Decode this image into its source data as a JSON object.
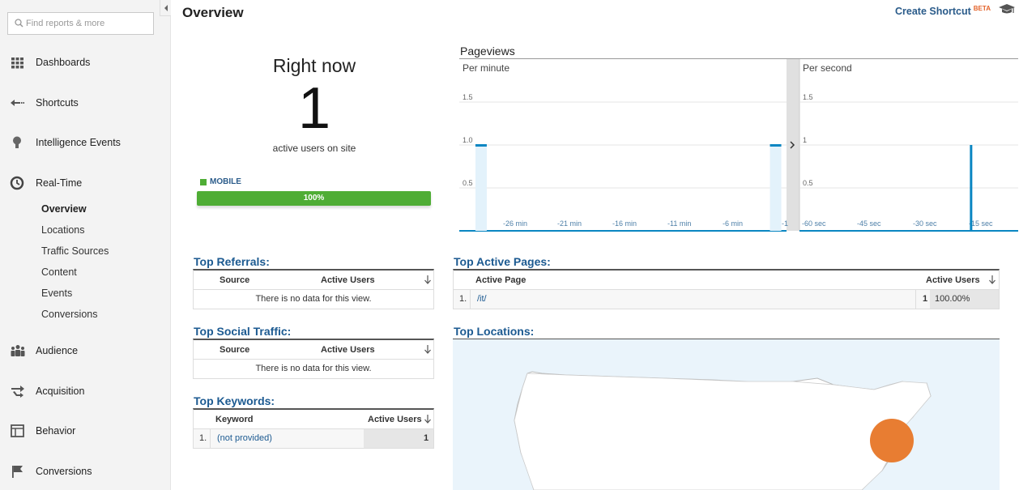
{
  "sidebar": {
    "search_placeholder": "Find reports & more",
    "items": [
      {
        "label": "Dashboards",
        "icon": "grid-icon"
      },
      {
        "label": "Shortcuts",
        "icon": "shortcut-arrow-icon"
      },
      {
        "label": "Intelligence Events",
        "icon": "lightbulb-icon"
      },
      {
        "label": "Real-Time",
        "icon": "clock-icon"
      },
      {
        "label": "Audience",
        "icon": "people-icon"
      },
      {
        "label": "Acquisition",
        "icon": "acquisition-arrows-icon"
      },
      {
        "label": "Behavior",
        "icon": "layout-icon"
      },
      {
        "label": "Conversions",
        "icon": "flag-icon"
      }
    ],
    "realtime_sub": [
      "Overview",
      "Locations",
      "Traffic Sources",
      "Content",
      "Events",
      "Conversions"
    ]
  },
  "header": {
    "title": "Overview",
    "shortcut_label": "Create Shortcut",
    "shortcut_badge": "BETA"
  },
  "right_now": {
    "title": "Right now",
    "count": "1",
    "subtitle": "active users on site",
    "device_label": "MOBILE",
    "device_percent_label": "100%",
    "device_percent": 1.0,
    "device_color": "#4fad35"
  },
  "pageviews": {
    "title": "Pageviews",
    "per_minute_label": "Per minute",
    "per_second_label": "Per second"
  },
  "chart_data": [
    {
      "type": "bar",
      "title": "Per minute",
      "y_ticks": [
        "0.5",
        "1.0",
        "1.5"
      ],
      "x_ticks": [
        "-26 min",
        "-21 min",
        "-16 min",
        "-11 min",
        "-6 min",
        "-1"
      ],
      "ylim": [
        0,
        2
      ],
      "series": [
        {
          "points": [
            {
              "x": -28,
              "y": 1
            },
            {
              "x": -1,
              "y": 1
            }
          ]
        }
      ],
      "color": "#0a86c2"
    },
    {
      "type": "bar",
      "title": "Per second",
      "y_ticks": [
        "0.5",
        "1",
        "1.5"
      ],
      "x_ticks": [
        "-60 sec",
        "-45 sec",
        "-30 sec",
        "-15 sec"
      ],
      "ylim": [
        0,
        2
      ],
      "series": [
        {
          "points": [
            {
              "x": -14,
              "y": 1
            }
          ]
        }
      ],
      "color": "#0a86c2"
    }
  ],
  "top_referrals": {
    "title": "Top Referrals:",
    "col_source": "Source",
    "col_active": "Active Users",
    "empty": "There is no data for this view."
  },
  "top_social": {
    "title": "Top Social Traffic:",
    "col_source": "Source",
    "col_active": "Active Users",
    "empty": "There is no data for this view."
  },
  "top_keywords": {
    "title": "Top Keywords:",
    "col_keyword": "Keyword",
    "col_active": "Active Users",
    "rows": [
      {
        "idx": "1.",
        "keyword": "(not provided)",
        "count": "1"
      }
    ]
  },
  "top_pages": {
    "title": "Top Active Pages:",
    "col_page": "Active Page",
    "col_active": "Active Users",
    "rows": [
      {
        "idx": "1.",
        "page": "/it/",
        "count": "1",
        "percent": "100.00%"
      }
    ]
  },
  "top_locations": {
    "title": "Top Locations:",
    "bubble_color": "#e87d32"
  }
}
